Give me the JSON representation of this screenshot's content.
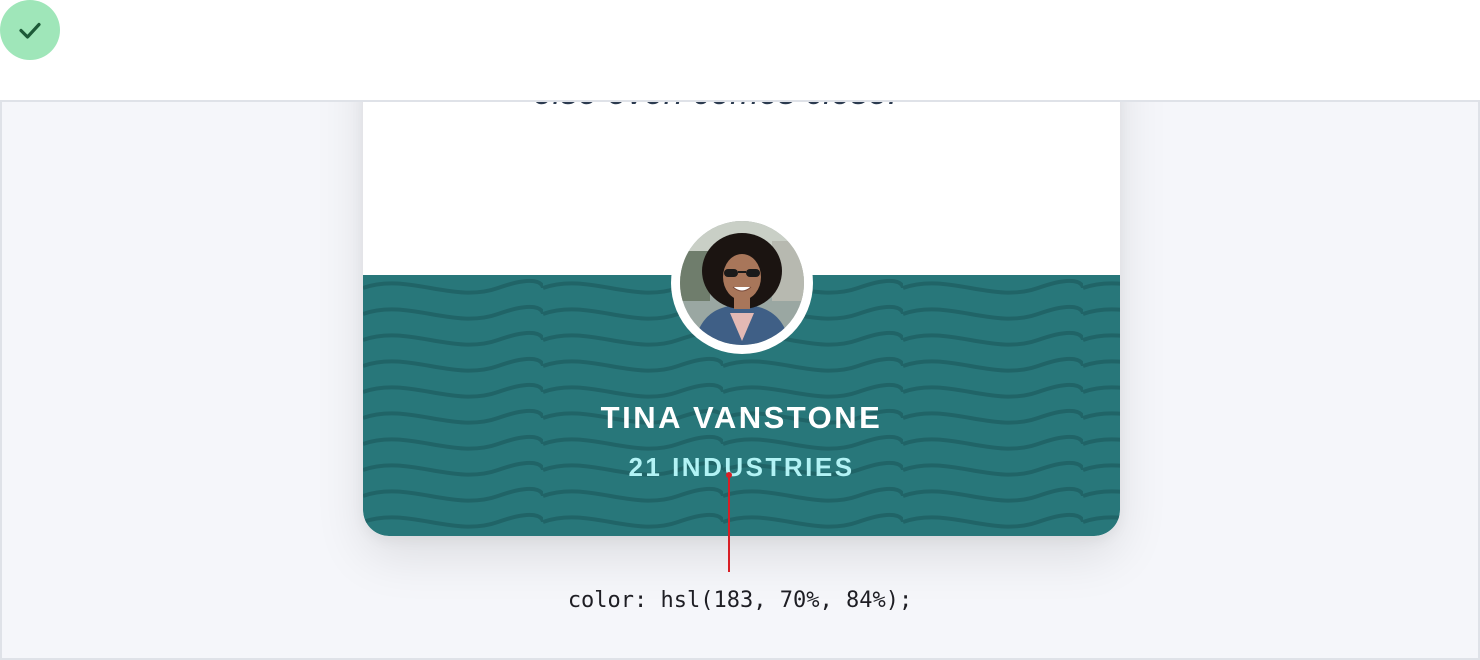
{
  "status": {
    "icon": "checkmark-icon",
    "color": "#9fe6b9"
  },
  "testimonial": {
    "quote_tail": "else even comes close.",
    "quote_mark_icon": "close-quote-icon",
    "name": "TINA VANSTONE",
    "company": "21 INDUSTRIES",
    "avatar": "portrait-photo"
  },
  "colors": {
    "teal_background": "#28777a",
    "company_text": "#b2f3f5",
    "pointer": "#d81f26"
  },
  "annotation": {
    "text": "color: hsl(183, 70%, 84%);"
  }
}
